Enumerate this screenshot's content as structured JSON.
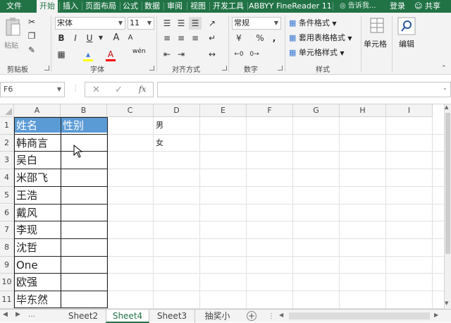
{
  "ribbon_tabs": [
    "文件",
    "开始",
    "插入",
    "页面布局",
    "公式",
    "数据",
    "审阅",
    "视图",
    "开发工具",
    "ABBYY FineReader 11"
  ],
  "active_tab": "开始",
  "tell_me": "告诉我...",
  "login": "登录",
  "share": "共享",
  "clipboard": {
    "paste": "粘贴",
    "group": "剪贴板"
  },
  "font": {
    "name": "宋体",
    "size": "11",
    "group": "字体",
    "bold": "B",
    "italic": "I",
    "underline": "U",
    "grow": "A",
    "shrink": "A",
    "color_letter": "A",
    "phonetic": "wén"
  },
  "alignment": {
    "group": "对齐方式"
  },
  "number": {
    "format": "常规",
    "group": "数字",
    "percent": "%",
    "comma": ","
  },
  "styles": {
    "conditional": "条件格式",
    "table": "套用表格格式",
    "cell_styles": "单元格样式",
    "group": "样式"
  },
  "cells": {
    "label": "单元格"
  },
  "editing": {
    "label": "编辑"
  },
  "formula_bar": {
    "name_box": "F6",
    "fx": "fx",
    "value": ""
  },
  "columns": [
    "A",
    "B",
    "C",
    "D",
    "E",
    "F",
    "G",
    "H",
    "I"
  ],
  "rows": [
    "1",
    "2",
    "3",
    "4",
    "5",
    "6",
    "7",
    "8",
    "9",
    "10",
    "11"
  ],
  "cells_data": {
    "A1": "姓名",
    "B1": "性别",
    "A2": "韩商言",
    "A3": "吴白",
    "A4": "米邵飞",
    "A5": "王浩",
    "A6": "戴风",
    "A7": "李现",
    "A8": "沈哲",
    "A9": "One",
    "A10": "欧强",
    "A11": "毕东然",
    "D1": "男",
    "D2": "女"
  },
  "sheet_tabs": [
    "Sheet2",
    "Sheet4",
    "Sheet3",
    "抽奖小"
  ],
  "active_sheet": "Sheet4",
  "colors": {
    "brand": "#217346",
    "header_fill": "#5b9bd5"
  }
}
